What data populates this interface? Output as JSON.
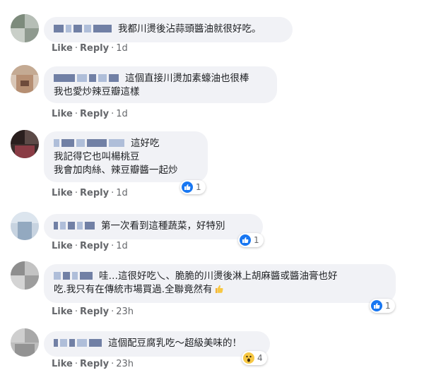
{
  "comments": [
    {
      "text": "我都川燙後沾蒜頭醬油就很好吃。",
      "actions": {
        "like": "Like",
        "reply": "Reply",
        "time": "1d"
      }
    },
    {
      "text": "這個直接川燙加素蠔油也很棒\n我也愛炒辣豆瓣這樣",
      "actions": {
        "like": "Like",
        "reply": "Reply",
        "time": "1d"
      }
    },
    {
      "text": "這好吃\n我記得它也叫楊桃豆\n我會加肉絲、辣豆瓣醬一起炒",
      "actions": {
        "like": "Like",
        "reply": "Reply",
        "time": "1d"
      },
      "reaction": {
        "type": "like",
        "count": "1"
      }
    },
    {
      "text": "第一次看到這種蔬菜，好特別",
      "actions": {
        "like": "Like",
        "reply": "Reply",
        "time": "1d"
      },
      "reaction": {
        "type": "like",
        "count": "1"
      }
    },
    {
      "text": "哇…這很好吃乀、脆脆的川燙後淋上胡麻醬或醬油膏也好\n吃.我只有在傳統市場買過.全聯竟然有",
      "actions": {
        "like": "Like",
        "reply": "Reply",
        "time": "23h"
      },
      "reaction": {
        "type": "like",
        "count": "1"
      }
    },
    {
      "text": "這個配豆腐乳吃～超級美味的！",
      "actions": {
        "like": "Like",
        "reply": "Reply",
        "time": "23h"
      },
      "reaction": {
        "type": "wow",
        "count": "4"
      }
    }
  ],
  "colors": {
    "bubble": "#f1f2f6",
    "like_blue": "#1877f2",
    "meta_gray": "#65676b"
  },
  "icons": {
    "like": "thumbs-up-icon",
    "wow": "wow-face-icon",
    "inline_emoji": "thumbs-up-emoji"
  }
}
